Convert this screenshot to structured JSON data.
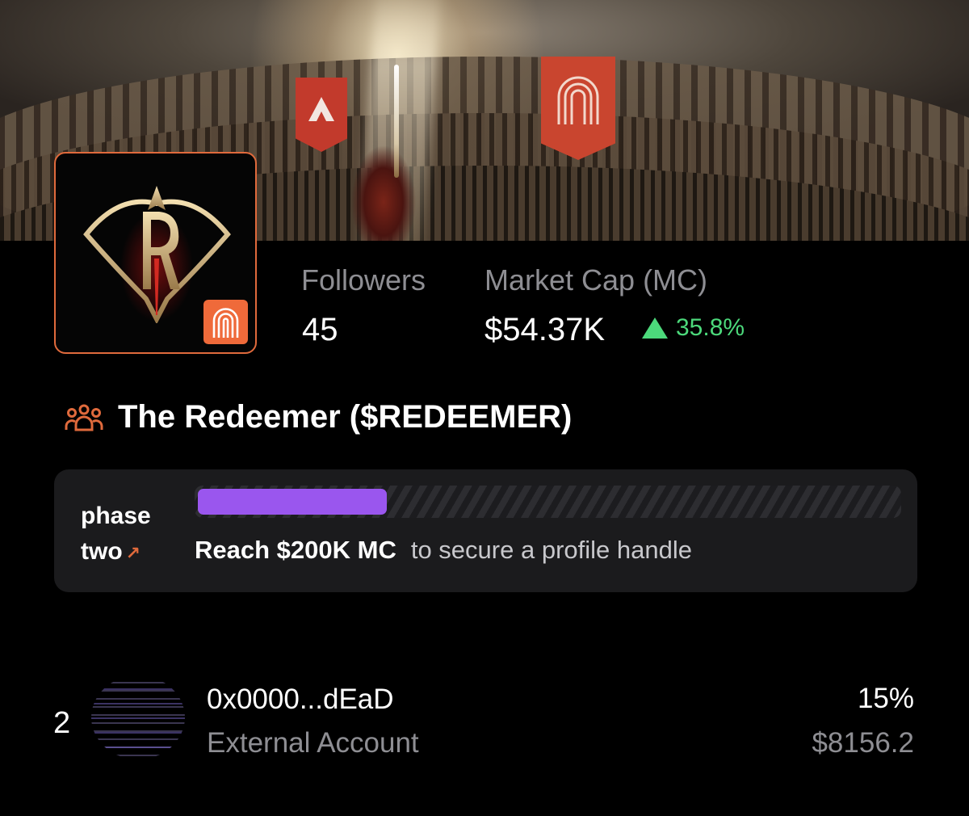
{
  "banner": {
    "scene": "arena"
  },
  "avatar": {
    "icon": "redeemer-emblem-icon",
    "badge_icon": "arch-logo-icon"
  },
  "stats": {
    "followers_label": "Followers",
    "followers_value": "45",
    "mc_label": "Market Cap (MC)",
    "mc_value": "$54.37K",
    "mc_change": "35.8%",
    "mc_change_direction": "up",
    "change_color": "#4cd97b"
  },
  "token": {
    "icon": "community-icon",
    "title": "The Redeemer ($REDEEMER)"
  },
  "phase": {
    "label_line1": "phase",
    "label_line2": "two",
    "arrow": "↗",
    "progress": 0.27,
    "goal_bold": "Reach $200K MC",
    "goal_rest": "to secure a profile handle",
    "progress_color": "#9a56ee"
  },
  "holders": [
    {
      "rank": "2",
      "address": "0x0000...dEaD",
      "type": "External Account",
      "percent": "15%",
      "usd": "$8156.2"
    }
  ],
  "accent_color": "#e06a3c"
}
